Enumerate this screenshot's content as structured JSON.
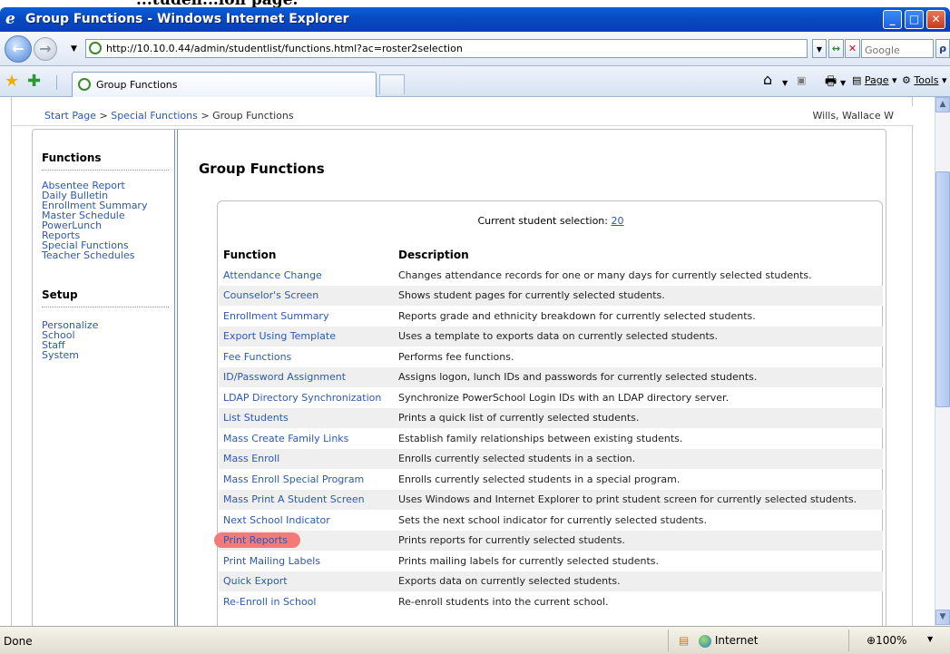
{
  "caption": "...tuden...ion page.",
  "window": {
    "title": "Group Functions - Windows Internet Explorer",
    "minimize": "_",
    "maximize": "□",
    "close": "✕"
  },
  "address": {
    "url": "http://10.10.0.44/admin/studentlist/functions.html?ac=roster2selection",
    "search_placeholder": "Google",
    "go_glyph": "↔",
    "stop_glyph": "✕",
    "search_glyph": "ρ"
  },
  "tabs": {
    "active_label": "Group Functions"
  },
  "commands": {
    "page": "Page",
    "tools": "Tools"
  },
  "breadcrumb": {
    "start": "Start Page",
    "sep": " > ",
    "special": "Special Functions",
    "current": "Group Functions"
  },
  "user": "Wills, Wallace W",
  "sidebar": {
    "functions_heading": "Functions",
    "functions": [
      "Absentee Report",
      "Daily Bulletin",
      "Enrollment Summary",
      "Master Schedule",
      "PowerLunch",
      "Reports",
      "Special Functions",
      "Teacher Schedules"
    ],
    "setup_heading": "Setup",
    "setup": [
      "Personalize",
      "School",
      "Staff",
      "System"
    ]
  },
  "main": {
    "title": "Group Functions",
    "selection_label": "Current student selection: ",
    "selection_count": "20",
    "col_function": "Function",
    "col_description": "Description",
    "rows": [
      {
        "fn": "Attendance Change",
        "desc": "Changes attendance records for one or many days for currently selected students."
      },
      {
        "fn": "Counselor's Screen",
        "desc": "Shows student pages for currently selected students."
      },
      {
        "fn": "Enrollment Summary",
        "desc": "Reports grade and ethnicity breakdown for currently selected students."
      },
      {
        "fn": "Export Using Template",
        "desc": "Uses a template to exports data on currently selected students."
      },
      {
        "fn": "Fee Functions",
        "desc": "Performs fee functions."
      },
      {
        "fn": "ID/Password Assignment",
        "desc": "Assigns logon, lunch IDs and passwords for currently selected students."
      },
      {
        "fn": "LDAP Directory Synchronization",
        "desc": "Synchronize PowerSchool Login IDs with an LDAP directory server."
      },
      {
        "fn": "List Students",
        "desc": "Prints a quick list of currently selected students."
      },
      {
        "fn": "Mass Create Family Links",
        "desc": "Establish family relationships between existing students."
      },
      {
        "fn": "Mass Enroll",
        "desc": "Enrolls currently selected students in a section."
      },
      {
        "fn": "Mass Enroll Special Program",
        "desc": "Enrolls currently selected students in a special program."
      },
      {
        "fn": "Mass Print A Student Screen",
        "desc": "Uses Windows and Internet Explorer to print student screen for currently selected students."
      },
      {
        "fn": "Next School Indicator",
        "desc": "Sets the next school indicator for currently selected students."
      },
      {
        "fn": "Print Reports",
        "desc": "Prints reports for currently selected students."
      },
      {
        "fn": "Print Mailing Labels",
        "desc": "Prints mailing labels for currently selected students."
      },
      {
        "fn": "Quick Export",
        "desc": "Exports data on currently selected students."
      },
      {
        "fn": "Re-Enroll in School",
        "desc": "Re-enroll students into the current school."
      }
    ]
  },
  "status": {
    "left": "Done",
    "zone": "Internet",
    "zoom": "100%"
  },
  "colors": {
    "link": "#2b59b0",
    "highlight": "#f47a7a",
    "title_bar": "#0848c0"
  }
}
